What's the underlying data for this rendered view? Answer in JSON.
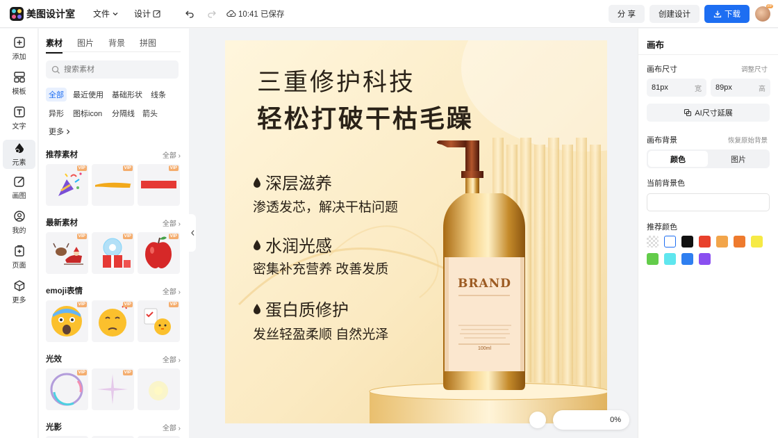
{
  "app": {
    "name": "美图设计室",
    "menu_file": "文件",
    "menu_design": "设计",
    "saved_status": "10:41 已保存",
    "share": "分 享",
    "create_design": "创建设计",
    "download": "下载",
    "avatar_badge": "VIP"
  },
  "leftnav": [
    {
      "label": "添加",
      "icon": "add-icon"
    },
    {
      "label": "模板",
      "icon": "template-icon"
    },
    {
      "label": "文字",
      "icon": "text-icon"
    },
    {
      "label": "元素",
      "icon": "element-icon"
    },
    {
      "label": "画图",
      "icon": "draw-icon"
    },
    {
      "label": "我的",
      "icon": "profile-icon"
    },
    {
      "label": "页面",
      "icon": "page-icon"
    },
    {
      "label": "更多",
      "icon": "more-icon"
    }
  ],
  "panel": {
    "tabs": [
      "素材",
      "图片",
      "背景",
      "拼图"
    ],
    "search_placeholder": "搜索素材",
    "chips": [
      "全部",
      "最近使用",
      "基础形状",
      "线条",
      "异形",
      "图标icon",
      "分隔线",
      "箭头",
      "更多"
    ],
    "all_label": "全部",
    "vip_label": "VIP",
    "sections": [
      "推荐素材",
      "最新素材",
      "emoji表情",
      "光效",
      "光影"
    ]
  },
  "poster": {
    "headline1": "三重修护科技",
    "headline2": "轻松打破干枯毛躁",
    "features": [
      {
        "title": "深层滋养",
        "desc": "渗透发芯，解决干枯问题"
      },
      {
        "title": "水润光感",
        "desc": "密集补充营养 改善发质"
      },
      {
        "title": "蛋白质修护",
        "desc": "发丝轻盈柔顺 自然光泽"
      }
    ],
    "bottle_brand": "BRAND",
    "bottle_volume": "100ml",
    "zoom": "0%"
  },
  "right": {
    "title": "画布",
    "size_label": "画布尺寸",
    "resize_link": "调整尺寸",
    "width_value": "81px",
    "width_unit": "宽",
    "height_value": "89px",
    "height_unit": "高",
    "ai_extend": "AI尺寸延展",
    "bg_label": "画布背景",
    "restore_link": "恢复原始背景",
    "seg_color": "颜色",
    "seg_image": "图片",
    "current_bg_label": "当前背景色",
    "recommended_label": "推荐颜色",
    "swatches": [
      "transparent",
      "#ffffff",
      "#111111",
      "#e8412c",
      "#f2a54a",
      "#ee7a2e",
      "#f6ea45",
      "#63cc4a",
      "#5fe6ee",
      "#2f7ff0",
      "#8a4ff0"
    ]
  }
}
